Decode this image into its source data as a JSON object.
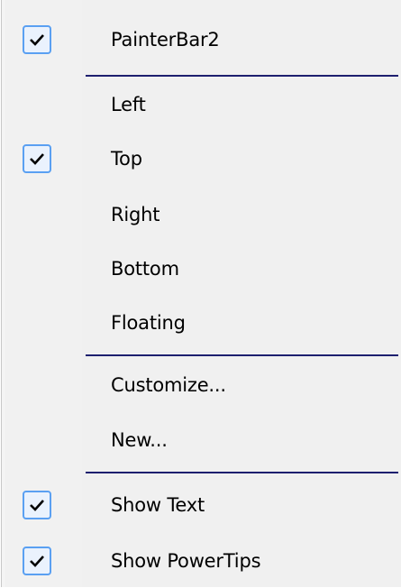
{
  "menu": {
    "items": [
      {
        "label": "PainterBar2",
        "checked": true
      },
      {
        "label": "Left",
        "checked": false
      },
      {
        "label": "Top",
        "checked": true
      },
      {
        "label": "Right",
        "checked": false
      },
      {
        "label": "Bottom",
        "checked": false
      },
      {
        "label": "Floating",
        "checked": false
      },
      {
        "label": "Customize...",
        "checked": false
      },
      {
        "label": "New...",
        "checked": false
      },
      {
        "label": "Show Text",
        "checked": true
      },
      {
        "label": "Show PowerTips",
        "checked": true
      }
    ],
    "check_icon": "check-icon",
    "colors": {
      "background": "#f0f0f0",
      "separator": "#1d1f6f",
      "check_border": "#5aa0f2"
    }
  }
}
